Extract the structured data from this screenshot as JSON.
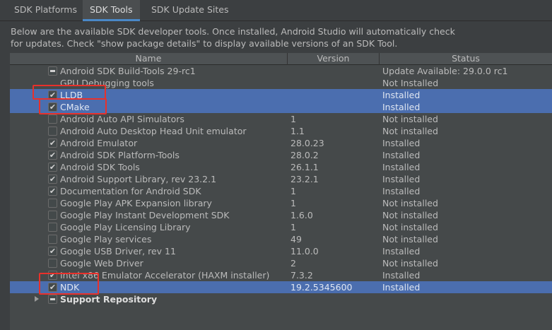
{
  "tabs": [
    {
      "label": "SDK Platforms",
      "active": false
    },
    {
      "label": "SDK Tools",
      "active": true
    },
    {
      "label": "SDK Update Sites",
      "active": false
    }
  ],
  "description": {
    "line1": "Below are the available SDK developer tools. Once installed, Android Studio will automatically check",
    "line2": "for updates. Check \"show package details\" to display available versions of an SDK Tool."
  },
  "table": {
    "headers": {
      "name": "Name",
      "version": "Version",
      "status": "Status"
    },
    "rows": [
      {
        "name": "Android SDK Build-Tools 29-rc1",
        "version": "",
        "status": "Update Available: 29.0.0 rc1",
        "check": "partial",
        "selected": false
      },
      {
        "name": "GPU Debugging tools",
        "version": "",
        "status": "Not Installed",
        "check": "none",
        "selected": false
      },
      {
        "name": "LLDB",
        "version": "",
        "status": "Installed",
        "check": "checked",
        "selected": true
      },
      {
        "name": "CMake",
        "version": "",
        "status": "Installed",
        "check": "checked",
        "selected": true
      },
      {
        "name": "Android Auto API Simulators",
        "version": "1",
        "status": "Not installed",
        "check": "unchecked",
        "selected": false
      },
      {
        "name": "Android Auto Desktop Head Unit emulator",
        "version": "1.1",
        "status": "Not installed",
        "check": "unchecked",
        "selected": false
      },
      {
        "name": "Android Emulator",
        "version": "28.0.23",
        "status": "Installed",
        "check": "checked",
        "selected": false
      },
      {
        "name": "Android SDK Platform-Tools",
        "version": "28.0.2",
        "status": "Installed",
        "check": "checked",
        "selected": false
      },
      {
        "name": "Android SDK Tools",
        "version": "26.1.1",
        "status": "Installed",
        "check": "checked",
        "selected": false
      },
      {
        "name": "Android Support Library, rev 23.2.1",
        "version": "23.2.1",
        "status": "Installed",
        "check": "checked",
        "selected": false
      },
      {
        "name": "Documentation for Android SDK",
        "version": "1",
        "status": "Installed",
        "check": "checked",
        "selected": false
      },
      {
        "name": "Google Play APK Expansion library",
        "version": "1",
        "status": "Not installed",
        "check": "unchecked",
        "selected": false
      },
      {
        "name": "Google Play Instant Development SDK",
        "version": "1.6.0",
        "status": "Not installed",
        "check": "unchecked",
        "selected": false
      },
      {
        "name": "Google Play Licensing Library",
        "version": "1",
        "status": "Not installed",
        "check": "unchecked",
        "selected": false
      },
      {
        "name": "Google Play services",
        "version": "49",
        "status": "Not installed",
        "check": "unchecked",
        "selected": false
      },
      {
        "name": "Google USB Driver, rev 11",
        "version": "11.0.0",
        "status": "Installed",
        "check": "checked",
        "selected": false
      },
      {
        "name": "Google Web Driver",
        "version": "2",
        "status": "Not installed",
        "check": "unchecked",
        "selected": false
      },
      {
        "name": "Intel x86 Emulator Accelerator (HAXM installer)",
        "version": "7.3.2",
        "status": "Installed",
        "check": "checked",
        "selected": false
      },
      {
        "name": "NDK",
        "version": "19.2.5345600",
        "status": "Installed",
        "check": "checked",
        "selected": true
      },
      {
        "name": "Support Repository",
        "version": "",
        "status": "",
        "check": "partial",
        "selected": false,
        "group": true
      }
    ]
  },
  "colors": {
    "background": "#3c3f41",
    "selection": "#4b6eaf",
    "highlight_box": "#e8312b",
    "active_tab_underline": "#4a88c7"
  }
}
